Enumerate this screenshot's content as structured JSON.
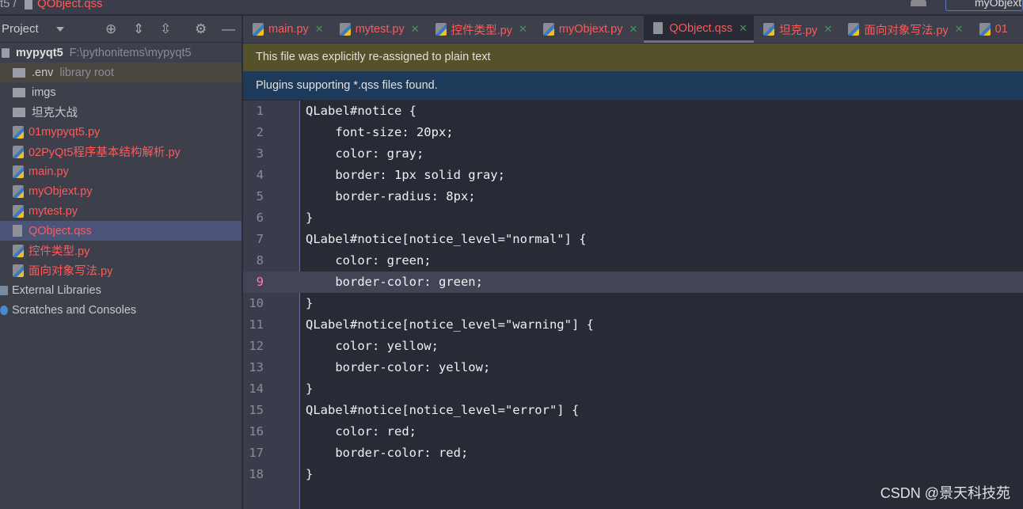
{
  "breadcrumb": {
    "project": "t5",
    "file": "QObject.qss"
  },
  "run_config": "myObjext",
  "sidebar": {
    "title": "Project",
    "tree": [
      {
        "label": "mypyqt5",
        "hint": "F:\\pythonitems\\mypyqt5",
        "type": "root"
      },
      {
        "label": ".env",
        "hint": "library root",
        "type": "folder"
      },
      {
        "label": "imgs",
        "type": "folder"
      },
      {
        "label": "坦克大战",
        "type": "folder"
      },
      {
        "label": "01mypyqt5.py",
        "type": "py"
      },
      {
        "label": "02PyQt5程序基本结构解析.py",
        "type": "py"
      },
      {
        "label": "main.py",
        "type": "py"
      },
      {
        "label": "myObjext.py",
        "type": "py"
      },
      {
        "label": "mytest.py",
        "type": "py"
      },
      {
        "label": "QObject.qss",
        "type": "qss",
        "selected": true
      },
      {
        "label": "控件类型.py",
        "type": "py"
      },
      {
        "label": "面向对象写法.py",
        "type": "py"
      },
      {
        "label": "External Libraries",
        "type": "lib"
      },
      {
        "label": "Scratches and Consoles",
        "type": "scratch"
      }
    ]
  },
  "tabs": [
    {
      "label": "main.py"
    },
    {
      "label": "mytest.py"
    },
    {
      "label": "控件类型.py"
    },
    {
      "label": "myObjext.py"
    },
    {
      "label": "QObject.qss",
      "active": true
    },
    {
      "label": "坦克.py"
    },
    {
      "label": "面向对象写法.py"
    },
    {
      "label": "01"
    }
  ],
  "banners": {
    "plain_text": "This file was explicitly re-assigned to plain text",
    "plugins": "Plugins supporting *.qss files found."
  },
  "editor": {
    "current_line": 9,
    "lines": [
      "QLabel#notice {",
      "    font-size: 20px;",
      "    color: gray;",
      "    border: 1px solid gray;",
      "    border-radius: 8px;",
      "}",
      "QLabel#notice[notice_level=\"normal\"] {",
      "    color: green;",
      "    border-color: green;",
      "}",
      "QLabel#notice[notice_level=\"warning\"] {",
      "    color: yellow;",
      "    border-color: yellow;",
      "}",
      "QLabel#notice[notice_level=\"error\"] {",
      "    color: red;",
      "    border-color: red;",
      "}"
    ]
  },
  "watermark": "CSDN @景天科技苑"
}
